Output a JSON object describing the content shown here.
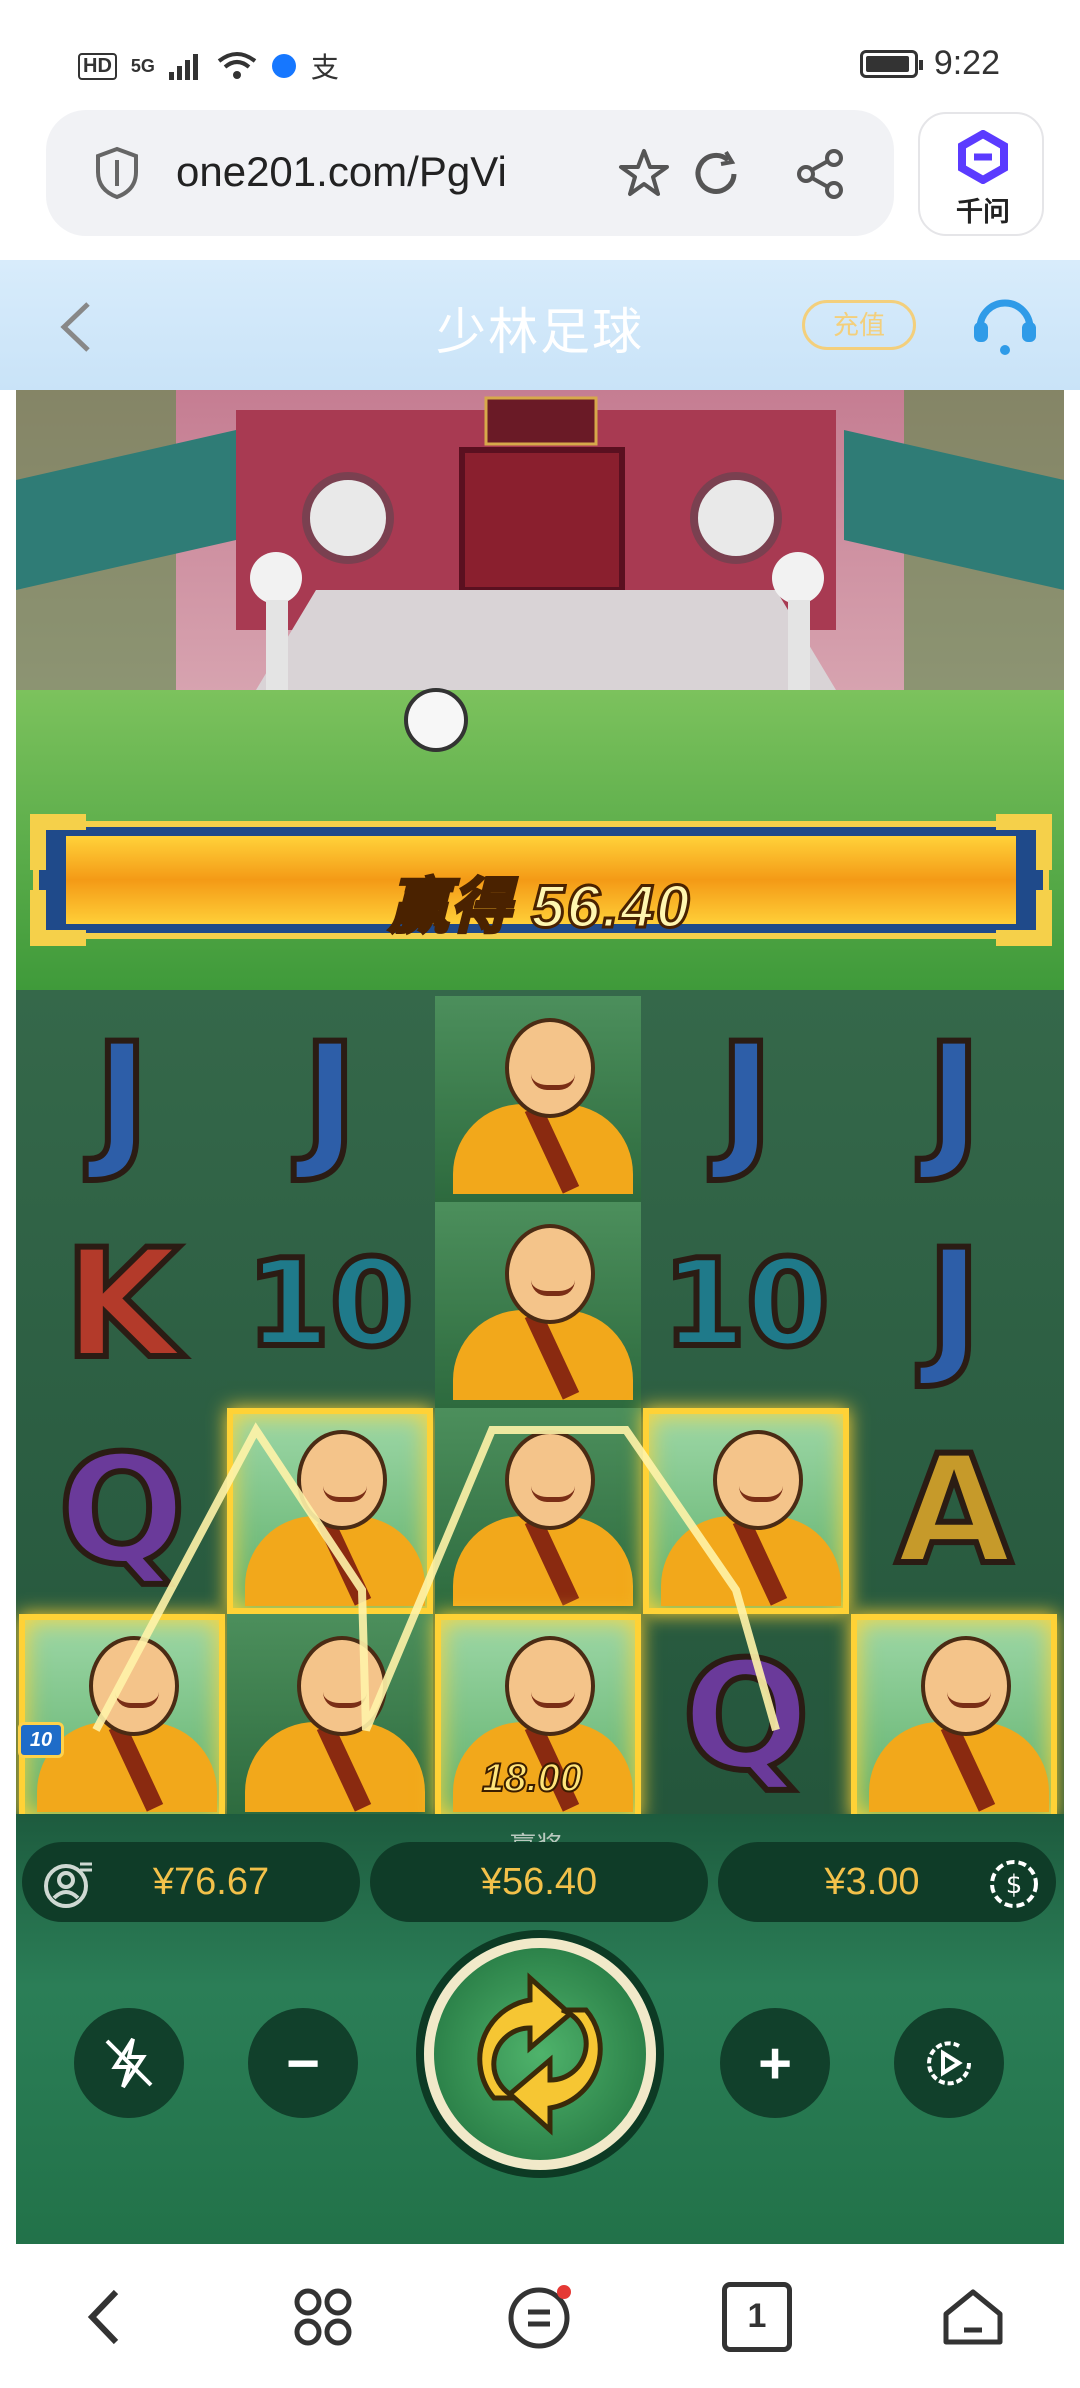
{
  "status_bar": {
    "left_icons": [
      "HD",
      "5G",
      "signal-icon",
      "wifi-icon",
      "alipay-icon",
      "browser-icon"
    ],
    "hd": "HD",
    "net": "5G",
    "time": "9:22"
  },
  "browser": {
    "url": "one201.com/PgVi",
    "qianwen_label": "千问"
  },
  "page": {
    "title": "少林足球",
    "recharge_label": "充值"
  },
  "game": {
    "win_banner": "赢得 56.40",
    "line_payout": "18.00",
    "multiplier_badge": "10",
    "reels": [
      [
        "J",
        "K",
        "Q",
        "monk"
      ],
      [
        "J",
        "10",
        "monk",
        "monk"
      ],
      [
        "monk",
        "monk",
        "monk",
        "monk"
      ],
      [
        "J",
        "10",
        "monk",
        "Q"
      ],
      [
        "J",
        "J",
        "A",
        "monk"
      ]
    ],
    "winning_cells": [
      [
        0,
        3
      ],
      [
        1,
        2
      ],
      [
        2,
        3
      ],
      [
        3,
        2
      ],
      [
        4,
        3
      ]
    ],
    "balance": "¥76.67",
    "win_label": "赢奖",
    "win_amount": "¥56.40",
    "bet": "¥3.00"
  },
  "colors": {
    "accent_gold": "#f2c14a",
    "title_bar": "#d8ecfb",
    "game_green": "#1e5b3e"
  },
  "nav_icons": [
    "back-icon",
    "apps-icon",
    "menu-icon",
    "tabs-icon",
    "home-icon"
  ],
  "tabs_count": "1"
}
